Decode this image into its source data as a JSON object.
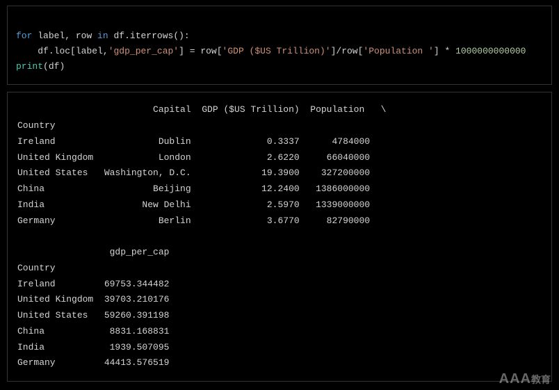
{
  "code": {
    "line1": {
      "for": "for",
      "label": "label",
      "comma": ", ",
      "row": "row",
      "in": " in ",
      "df": "df",
      "dot": ".",
      "iterrows": "iterrows",
      "parens": "():"
    },
    "line2": {
      "indent": "    ",
      "df": "df",
      "dot1": ".",
      "loc": "loc",
      "lbrack": "[",
      "label": "label",
      "comma": ",",
      "str_gpc": "'gdp_per_cap'",
      "rbrack": "]",
      "eq": " = ",
      "row1": "row",
      "lb1": "[",
      "str_gdp": "'GDP ($US Trillion)'",
      "rb1": "]",
      "div": "/",
      "row2": "row",
      "lb2": "[",
      "str_pop": "'Population '",
      "rb2": "]",
      "mul": " * ",
      "num": "1000000000000"
    },
    "line3": {
      "print": "print",
      "lp": "(",
      "df": "df",
      "rp": ")"
    }
  },
  "output": {
    "table1": {
      "header": "                         Capital  GDP ($US Trillion)  Population   \\",
      "indexlabel": "Country                                                              ",
      "rows": [
        "Ireland                   Dublin              0.3337      4784000   ",
        "United Kingdom            London              2.6220     66040000   ",
        "United States   Washington, D.C.             19.3900    327200000   ",
        "China                    Beijing             12.2400   1386000000   ",
        "India                  New Delhi              2.5970   1339000000   ",
        "Germany                   Berlin              3.6770     82790000   "
      ]
    },
    "blank": "",
    "table2": {
      "header": "                 gdp_per_cap  ",
      "indexlabel": "Country                       ",
      "rows": [
        "Ireland         69753.344482  ",
        "United Kingdom  39703.210176  ",
        "United States   59260.391198  ",
        "China            8831.168831  ",
        "India            1939.507095  ",
        "Germany         44413.576519  "
      ]
    }
  },
  "watermark": {
    "main": "AAA",
    "sub": "教育"
  }
}
